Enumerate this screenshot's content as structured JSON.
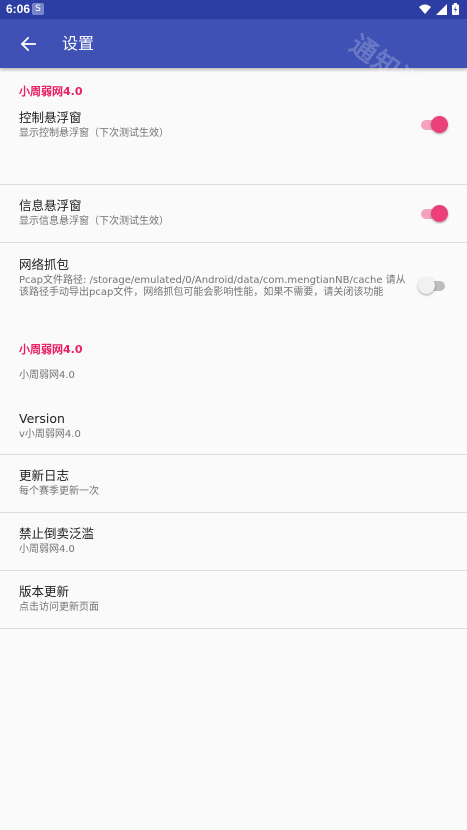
{
  "status_bar": {
    "time": "6:06",
    "app_icon": "s-app-icon",
    "icons": [
      "wifi-icon",
      "signal-icon",
      "battery-icon"
    ]
  },
  "app_bar": {
    "back_icon": "arrow-left-icon",
    "title": "设置",
    "watermark": "通知消息"
  },
  "sections": [
    {
      "category": "小周弱网4.0",
      "items": [
        {
          "title": "控制悬浮窗",
          "summary": "显示控制悬浮窗（下次测试生效）",
          "switch": true
        },
        {
          "title": "信息悬浮窗",
          "summary": "显示信息悬浮窗（下次测试生效）",
          "switch": true
        },
        {
          "title": "网络抓包",
          "summary": "Pcap文件路径: /storage/emulated/0/Android/data/com.mengtianNB/cache 请从该路径手动导出pcap文件，网络抓包可能会影响性能，如果不需要，请关闭该功能",
          "switch": false
        }
      ]
    },
    {
      "category": "小周弱网4.0",
      "items": [
        {
          "title": "",
          "summary": "小周弱网4.0"
        },
        {
          "title": "Version",
          "summary": "v小周弱网4.0"
        },
        {
          "title": "更新日志",
          "summary": "每个赛季更新一次"
        },
        {
          "title": "禁止倒卖泛滥",
          "summary": "小周弱网4.0"
        },
        {
          "title": "版本更新",
          "summary": "点击访问更新页面"
        }
      ]
    }
  ],
  "colors": {
    "status_bar": "#2c3da3",
    "app_bar": "#3f51b5",
    "accent": "#e91e63",
    "switch_on": "#ec407a"
  }
}
